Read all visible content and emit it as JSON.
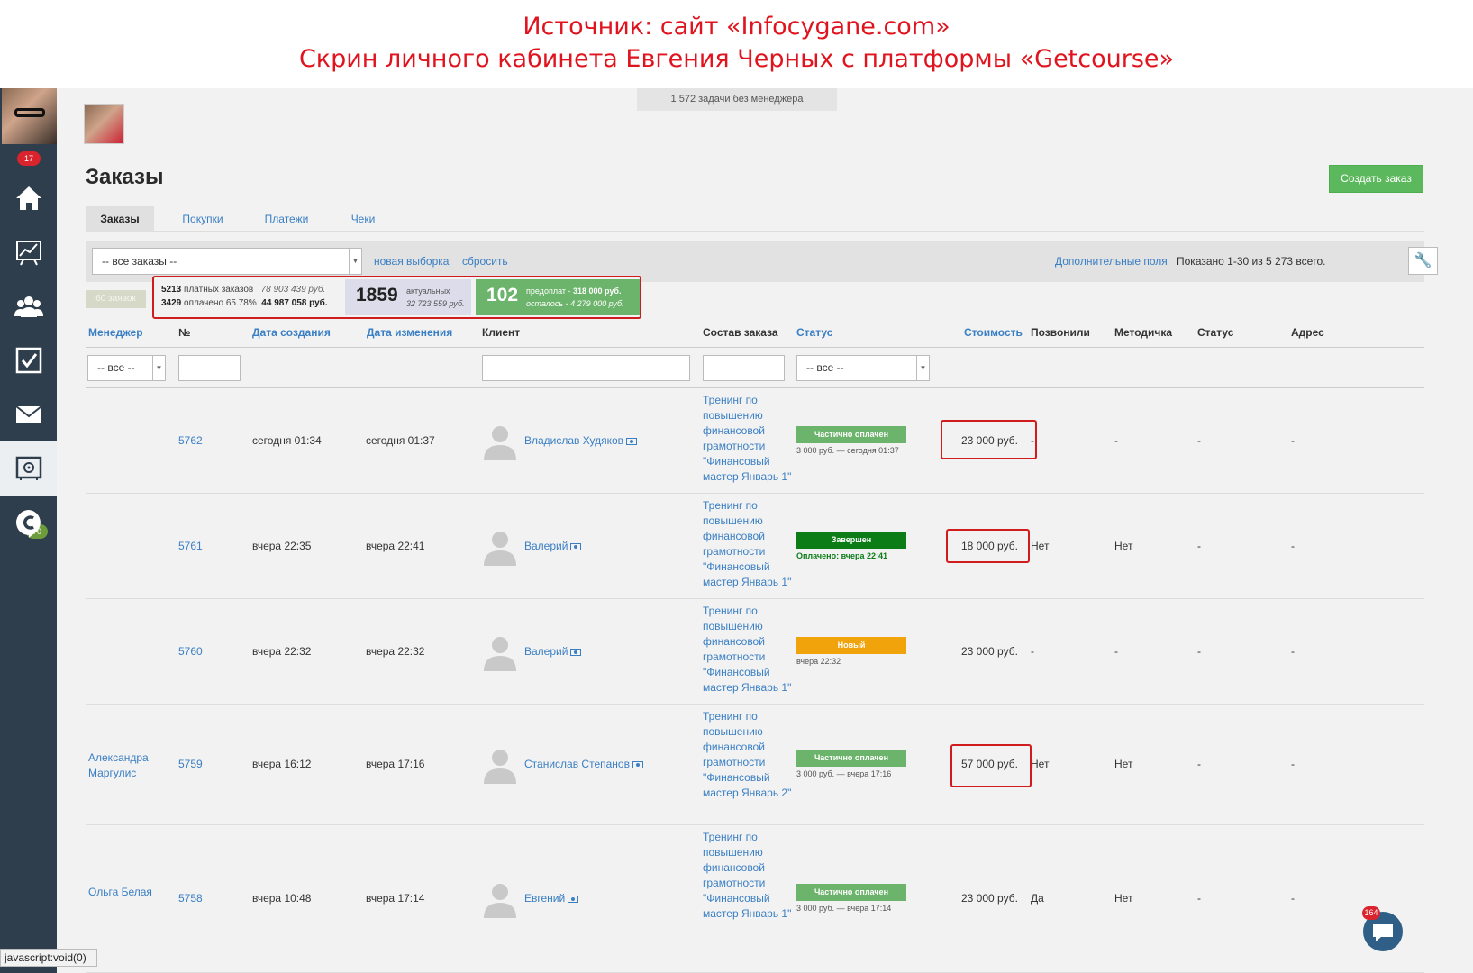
{
  "caption": {
    "line1": "Источник: сайт «Infocygane.com»",
    "line2": "Скрин личного кабинета Евгения Черных с платформы «Getcourse»"
  },
  "sidebar": {
    "notifications_badge": "17",
    "mail_badge": "70",
    "items": [
      "home-icon",
      "chart-icon",
      "users-icon",
      "tasks-icon",
      "mail-icon",
      "safe-icon",
      "chat-brand-icon"
    ]
  },
  "topbar": {
    "unassigned_tasks": "1 572 задачи без менеджера"
  },
  "page": {
    "title": "Заказы",
    "create_button": "Создать заказ"
  },
  "tabs": [
    {
      "label": "Заказы"
    },
    {
      "label": "Покупки"
    },
    {
      "label": "Платежи"
    },
    {
      "label": "Чеки"
    }
  ],
  "filter": {
    "selection": "-- все заказы --",
    "new_selection": "новая выборка",
    "reset": "сбросить",
    "extra_fields": "Дополнительные поля",
    "shown": "Показано 1-30 из 5 273 всего."
  },
  "stats": {
    "requests_pill": "60 заявок",
    "paid_orders_count": "5213",
    "paid_orders_label": "платных заказов",
    "paid_orders_sum": "78 903 439 руб.",
    "paid_count": "3429",
    "paid_label": "оплачено 65.78%",
    "paid_sum": "44 987 058 руб.",
    "actual_count": "1859",
    "actual_label": "актуальных",
    "actual_sum": "32 723 559 руб.",
    "prepay_count": "102",
    "prepay_label": "предоплат -",
    "prepay_sum": "318 000 руб.",
    "remaining": "осталось - 4 279 000 руб."
  },
  "table": {
    "headers": {
      "manager": "Менеджер",
      "number": "№",
      "created": "Дата создания",
      "changed": "Дата изменения",
      "client": "Клиент",
      "composition": "Состав заказа",
      "status": "Статус",
      "cost": "Стоимость",
      "called": "Позвонили",
      "manual": "Методичка",
      "status2": "Статус",
      "address": "Адрес"
    },
    "filter_all": "-- все --",
    "rows": [
      {
        "manager": "",
        "number": "5762",
        "created": "сегодня 01:34",
        "changed": "сегодня 01:37",
        "client": "Владислав Худяков",
        "composition": "Тренинг по повышению финансовой грамотности \"Финансовый мастер Январь 1\"",
        "status": "Частично оплачен",
        "status_color": "#6cb36b",
        "status_sub": "3 000 руб. — сегодня 01:37",
        "cost": "23 000 руб.",
        "called": "-",
        "manual": "-",
        "status2": "-",
        "address": "-"
      },
      {
        "manager": "",
        "number": "5761",
        "created": "вчера 22:35",
        "changed": "вчера 22:41",
        "client": "Валерий",
        "composition": "Тренинг по повышению финансовой грамотности \"Финансовый мастер Январь 1\"",
        "status": "Завершен",
        "status_color": "#0b7c16",
        "status_sub": "Оплачено: вчера 22:41",
        "cost": "18 000 руб.",
        "called": "Нет",
        "manual": "Нет",
        "status2": "-",
        "address": "-"
      },
      {
        "manager": "",
        "number": "5760",
        "created": "вчера 22:32",
        "changed": "вчера 22:32",
        "client": "Валерий",
        "composition": "Тренинг по повышению финансовой грамотности \"Финансовый мастер Январь 1\"",
        "status": "Новый",
        "status_color": "#f0a30a",
        "status_sub": "вчера 22:32",
        "cost": "23 000 руб.",
        "called": "-",
        "manual": "-",
        "status2": "-",
        "address": "-"
      },
      {
        "manager": "Александра Маргулис",
        "number": "5759",
        "created": "вчера 16:12",
        "changed": "вчера 17:16",
        "client": "Станислав Степанов",
        "composition": "Тренинг по повышению финансовой грамотности \"Финансовый мастер Январь 2\"",
        "status": "Частично оплачен",
        "status_color": "#6cb36b",
        "status_sub": "3 000 руб. — вчера 17:16",
        "cost": "57 000 руб.",
        "called": "Нет",
        "manual": "Нет",
        "status2": "-",
        "address": "-"
      },
      {
        "manager": "Ольга Белая",
        "number": "5758",
        "created": "вчера 10:48",
        "changed": "вчера 17:14",
        "client": "Евгений",
        "composition": "Тренинг по повышению финансовой грамотности \"Финансовый мастер Январь 1\"",
        "status": "Частично оплачен",
        "status_color": "#6cb36b",
        "status_sub": "3 000 руб. — вчера 17:14",
        "cost": "23 000 руб.",
        "called": "Да",
        "manual": "Нет",
        "status2": "-",
        "address": "-"
      }
    ]
  },
  "browser": {
    "status_url": "javascript:void(0)"
  },
  "chat": {
    "badge": "164"
  }
}
